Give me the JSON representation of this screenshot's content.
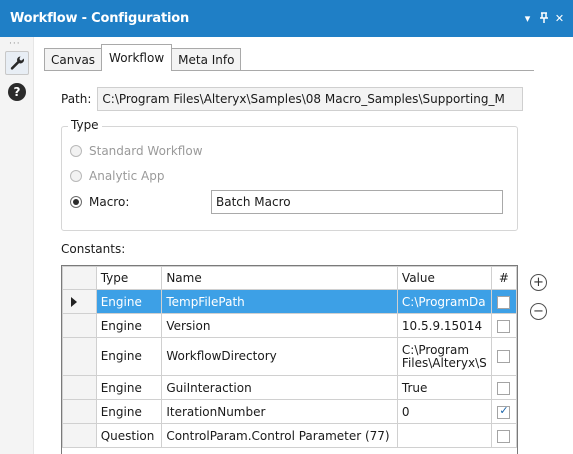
{
  "window": {
    "title": "Workflow - Configuration",
    "controls": [
      "▾",
      "ᵽ",
      "✕"
    ]
  },
  "sidebar": {
    "dots": "···"
  },
  "tabs": [
    "Canvas",
    "Workflow",
    "Meta Info"
  ],
  "active_tab": "Workflow",
  "path": {
    "label": "Path:",
    "value": "C:\\Program Files\\Alteryx\\Samples\\08 Macro_Samples\\Supporting_M"
  },
  "type_group": {
    "legend": "Type",
    "options": [
      "Standard Workflow",
      "Analytic App",
      "Macro:"
    ],
    "selected": "Macro:",
    "macro_value": "Batch Macro"
  },
  "constants": {
    "label": "Constants:",
    "columns": [
      "Type",
      "Name",
      "Value",
      "#"
    ],
    "rows": [
      {
        "type": "Engine",
        "name": "TempFilePath",
        "value": "C:\\ProgramDa",
        "checked": false,
        "selected": true
      },
      {
        "type": "Engine",
        "name": "Version",
        "value": "10.5.9.15014",
        "checked": false
      },
      {
        "type": "Engine",
        "name": "WorkflowDirectory",
        "value_line1": "C:\\Program",
        "value_line2": "Files\\Alteryx\\S",
        "checked": false
      },
      {
        "type": "Engine",
        "name": "GuiInteraction",
        "value": "True",
        "checked": false
      },
      {
        "type": "Engine",
        "name": "IterationNumber",
        "value": "0",
        "checked": true
      },
      {
        "type": "Question",
        "name": "ControlParam.Control Parameter (77)",
        "value": "",
        "checked": false
      }
    ]
  },
  "buttons": {
    "add": "+",
    "remove": "−"
  }
}
